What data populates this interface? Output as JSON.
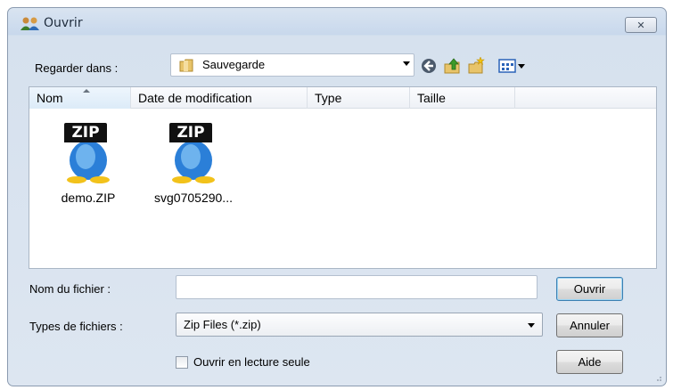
{
  "window": {
    "title": "Ouvrir",
    "close_glyph": "✕"
  },
  "lookin": {
    "label": "Regarder dans :",
    "value": "Sauvegarde"
  },
  "toolbar": {
    "icons": [
      "back-icon",
      "up-folder-icon",
      "new-folder-icon",
      "view-menu-icon"
    ]
  },
  "filelist": {
    "columns": [
      "Nom",
      "Date de modification",
      "Type",
      "Taille"
    ],
    "files": [
      {
        "badge": "ZIP",
        "name": "demo.ZIP"
      },
      {
        "badge": "ZIP",
        "name": "svg0705290..."
      }
    ]
  },
  "form": {
    "filename_label": "Nom du fichier :",
    "filename_value": "",
    "types_label": "Types de fichiers :",
    "types_value": "Zip Files (*.zip)",
    "readonly_label": "Ouvrir en lecture seule"
  },
  "buttons": {
    "open": "Ouvrir",
    "cancel": "Annuler",
    "help": "Aide"
  },
  "colors": {
    "accent": "#3c7fb1",
    "zip_blue": "#2b7fd8",
    "zip_head": "#f2c21b"
  }
}
